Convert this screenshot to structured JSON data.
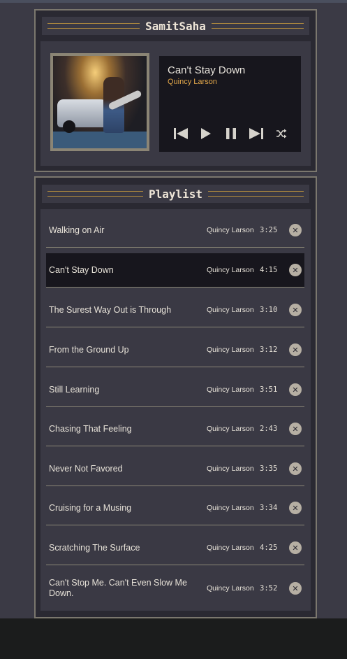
{
  "app": {
    "title": "SamitSaha"
  },
  "now_playing": {
    "title": "Can't Stay Down",
    "artist": "Quincy Larson"
  },
  "icons": {
    "previous": "skip-back-icon",
    "play": "play-icon",
    "pause": "pause-icon",
    "next": "skip-forward-icon",
    "shuffle": "shuffle-icon",
    "remove": "close-icon",
    "remove_glyph": "✕"
  },
  "playlist": {
    "title": "Playlist",
    "tracks": [
      {
        "title": "Walking on Air",
        "artist": "Quincy Larson",
        "duration": "3:25"
      },
      {
        "title": "Can't Stay Down",
        "artist": "Quincy Larson",
        "duration": "4:15"
      },
      {
        "title": "The Surest Way Out is Through",
        "artist": "Quincy Larson",
        "duration": "3:10"
      },
      {
        "title": "From the Ground Up",
        "artist": "Quincy Larson",
        "duration": "3:12"
      },
      {
        "title": "Still Learning",
        "artist": "Quincy Larson",
        "duration": "3:51"
      },
      {
        "title": "Chasing That Feeling",
        "artist": "Quincy Larson",
        "duration": "2:43"
      },
      {
        "title": "Never Not Favored",
        "artist": "Quincy Larson",
        "duration": "3:35"
      },
      {
        "title": "Cruising for a Musing",
        "artist": "Quincy Larson",
        "duration": "3:34"
      },
      {
        "title": "Scratching The Surface",
        "artist": "Quincy Larson",
        "duration": "4:25"
      },
      {
        "title": "Can't Stop Me. Can't Even Slow Me Down.",
        "artist": "Quincy Larson",
        "duration": "3:52"
      }
    ],
    "active_index": 1
  },
  "colors": {
    "accent": "#e1a64a",
    "rule": "#b08a3e",
    "panel_border": "#7b776e",
    "active_row": "#17161d"
  }
}
